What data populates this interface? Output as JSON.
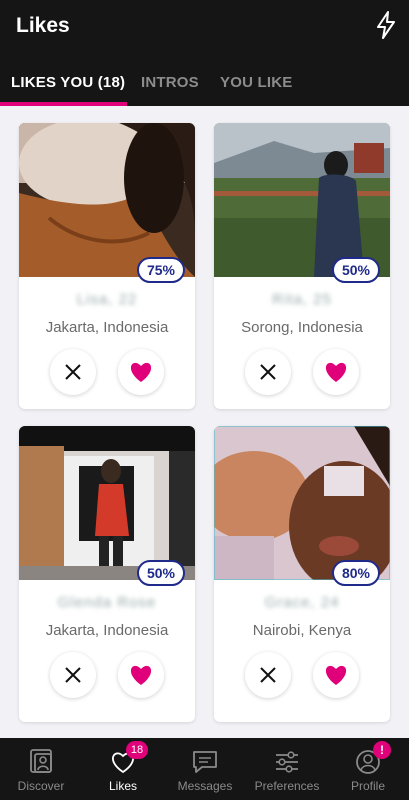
{
  "header": {
    "title": "Likes",
    "action_icon": "lightning-bolt-icon"
  },
  "tabs": [
    {
      "label": "LIKES YOU (18)",
      "active": true
    },
    {
      "label": "INTROS",
      "active": false
    },
    {
      "label": "YOU LIKE",
      "active": false
    }
  ],
  "cards": [
    {
      "match": "75%",
      "name": "Lisa, 22",
      "location": "Jakarta, Indonesia"
    },
    {
      "match": "50%",
      "name": "Rita, 25",
      "location": "Sorong, Indonesia"
    },
    {
      "match": "50%",
      "name": "Glenda Rose",
      "location": "Jakarta, Indonesia"
    },
    {
      "match": "80%",
      "name": "Grace, 24",
      "location": "Nairobi, Kenya"
    }
  ],
  "actions": {
    "pass_icon": "close-icon",
    "like_icon": "heart-icon"
  },
  "bottom_nav": [
    {
      "label": "Discover",
      "icon": "discover-icon",
      "active": false
    },
    {
      "label": "Likes",
      "icon": "heart-outline-icon",
      "active": true,
      "badge": "18"
    },
    {
      "label": "Messages",
      "icon": "chat-icon",
      "active": false
    },
    {
      "label": "Preferences",
      "icon": "sliders-icon",
      "active": false
    },
    {
      "label": "Profile",
      "icon": "profile-icon",
      "active": false,
      "badge": "!"
    }
  ],
  "colors": {
    "accent": "#e0007a",
    "badge_border": "#1f2a8a",
    "bar": "#151515"
  }
}
